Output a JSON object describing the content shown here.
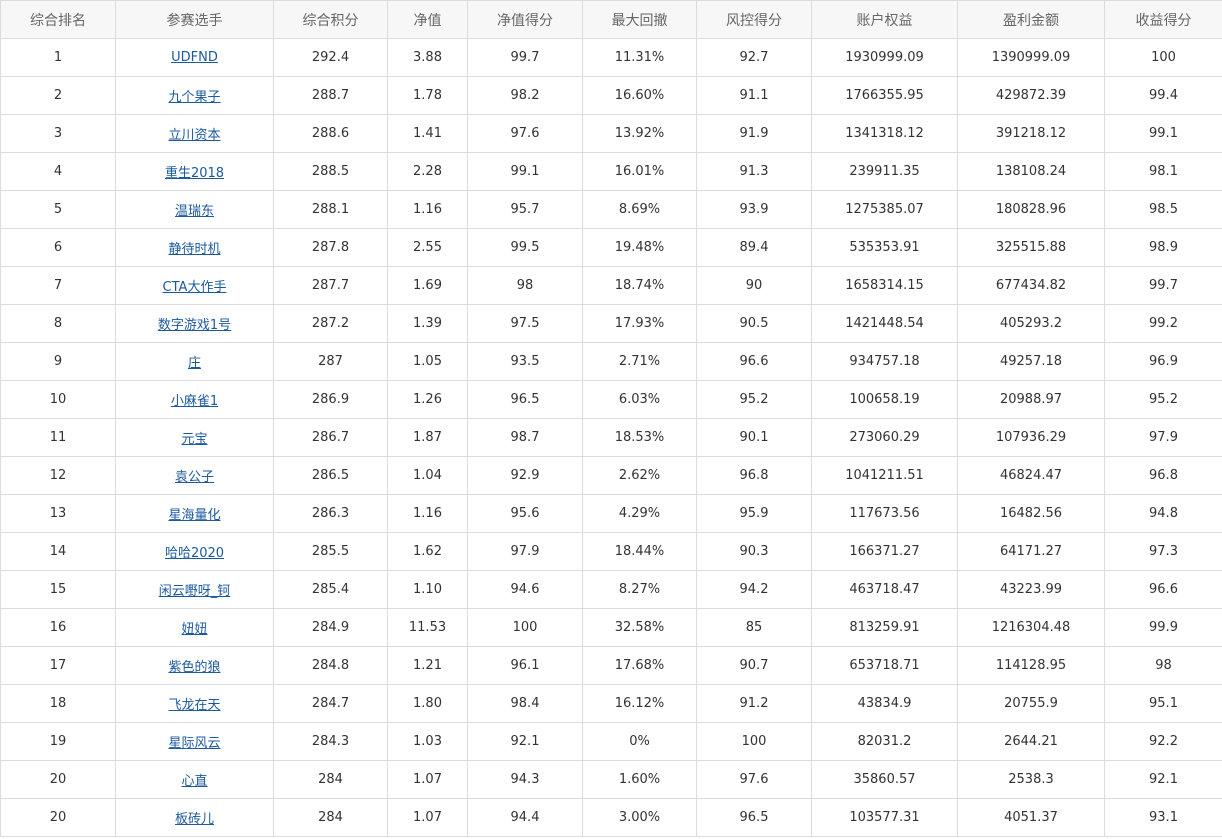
{
  "headers": [
    "综合排名",
    "参赛选手",
    "综合积分",
    "净值",
    "净值得分",
    "最大回撤",
    "风控得分",
    "账户权益",
    "盈利金额",
    "收益得分"
  ],
  "rows": [
    {
      "rank": "1",
      "name": "UDFND",
      "score": "292.4",
      "nav": "3.88",
      "nav_score": "99.7",
      "drawdown": "11.31%",
      "risk_score": "92.7",
      "equity": "1930999.09",
      "profit": "1390999.09",
      "return_score": "100"
    },
    {
      "rank": "2",
      "name": "九个果子",
      "score": "288.7",
      "nav": "1.78",
      "nav_score": "98.2",
      "drawdown": "16.60%",
      "risk_score": "91.1",
      "equity": "1766355.95",
      "profit": "429872.39",
      "return_score": "99.4"
    },
    {
      "rank": "3",
      "name": "立川资本",
      "score": "288.6",
      "nav": "1.41",
      "nav_score": "97.6",
      "drawdown": "13.92%",
      "risk_score": "91.9",
      "equity": "1341318.12",
      "profit": "391218.12",
      "return_score": "99.1"
    },
    {
      "rank": "4",
      "name": "重生2018",
      "score": "288.5",
      "nav": "2.28",
      "nav_score": "99.1",
      "drawdown": "16.01%",
      "risk_score": "91.3",
      "equity": "239911.35",
      "profit": "138108.24",
      "return_score": "98.1"
    },
    {
      "rank": "5",
      "name": "温瑞东",
      "score": "288.1",
      "nav": "1.16",
      "nav_score": "95.7",
      "drawdown": "8.69%",
      "risk_score": "93.9",
      "equity": "1275385.07",
      "profit": "180828.96",
      "return_score": "98.5"
    },
    {
      "rank": "6",
      "name": "静待时机",
      "score": "287.8",
      "nav": "2.55",
      "nav_score": "99.5",
      "drawdown": "19.48%",
      "risk_score": "89.4",
      "equity": "535353.91",
      "profit": "325515.88",
      "return_score": "98.9"
    },
    {
      "rank": "7",
      "name": "CTA大作手",
      "score": "287.7",
      "nav": "1.69",
      "nav_score": "98",
      "drawdown": "18.74%",
      "risk_score": "90",
      "equity": "1658314.15",
      "profit": "677434.82",
      "return_score": "99.7"
    },
    {
      "rank": "8",
      "name": "数字游戏1号",
      "score": "287.2",
      "nav": "1.39",
      "nav_score": "97.5",
      "drawdown": "17.93%",
      "risk_score": "90.5",
      "equity": "1421448.54",
      "profit": "405293.2",
      "return_score": "99.2"
    },
    {
      "rank": "9",
      "name": "庄",
      "score": "287",
      "nav": "1.05",
      "nav_score": "93.5",
      "drawdown": "2.71%",
      "risk_score": "96.6",
      "equity": "934757.18",
      "profit": "49257.18",
      "return_score": "96.9"
    },
    {
      "rank": "10",
      "name": "小麻雀1",
      "score": "286.9",
      "nav": "1.26",
      "nav_score": "96.5",
      "drawdown": "6.03%",
      "risk_score": "95.2",
      "equity": "100658.19",
      "profit": "20988.97",
      "return_score": "95.2"
    },
    {
      "rank": "11",
      "name": "元宝",
      "score": "286.7",
      "nav": "1.87",
      "nav_score": "98.7",
      "drawdown": "18.53%",
      "risk_score": "90.1",
      "equity": "273060.29",
      "profit": "107936.29",
      "return_score": "97.9"
    },
    {
      "rank": "12",
      "name": "袁公子",
      "score": "286.5",
      "nav": "1.04",
      "nav_score": "92.9",
      "drawdown": "2.62%",
      "risk_score": "96.8",
      "equity": "1041211.51",
      "profit": "46824.47",
      "return_score": "96.8"
    },
    {
      "rank": "13",
      "name": "星海量化",
      "score": "286.3",
      "nav": "1.16",
      "nav_score": "95.6",
      "drawdown": "4.29%",
      "risk_score": "95.9",
      "equity": "117673.56",
      "profit": "16482.56",
      "return_score": "94.8"
    },
    {
      "rank": "14",
      "name": "哈哈2020",
      "score": "285.5",
      "nav": "1.62",
      "nav_score": "97.9",
      "drawdown": "18.44%",
      "risk_score": "90.3",
      "equity": "166371.27",
      "profit": "64171.27",
      "return_score": "97.3"
    },
    {
      "rank": "15",
      "name": "闲云嘢呀_钶",
      "score": "285.4",
      "nav": "1.10",
      "nav_score": "94.6",
      "drawdown": "8.27%",
      "risk_score": "94.2",
      "equity": "463718.47",
      "profit": "43223.99",
      "return_score": "96.6"
    },
    {
      "rank": "16",
      "name": "妞妞",
      "score": "284.9",
      "nav": "11.53",
      "nav_score": "100",
      "drawdown": "32.58%",
      "risk_score": "85",
      "equity": "813259.91",
      "profit": "1216304.48",
      "return_score": "99.9"
    },
    {
      "rank": "17",
      "name": "紫色的狼",
      "score": "284.8",
      "nav": "1.21",
      "nav_score": "96.1",
      "drawdown": "17.68%",
      "risk_score": "90.7",
      "equity": "653718.71",
      "profit": "114128.95",
      "return_score": "98"
    },
    {
      "rank": "18",
      "name": "飞龙在天",
      "score": "284.7",
      "nav": "1.80",
      "nav_score": "98.4",
      "drawdown": "16.12%",
      "risk_score": "91.2",
      "equity": "43834.9",
      "profit": "20755.9",
      "return_score": "95.1"
    },
    {
      "rank": "19",
      "name": "星际风云",
      "score": "284.3",
      "nav": "1.03",
      "nav_score": "92.1",
      "drawdown": "0%",
      "risk_score": "100",
      "equity": "82031.2",
      "profit": "2644.21",
      "return_score": "92.2"
    },
    {
      "rank": "20",
      "name": "心直",
      "score": "284",
      "nav": "1.07",
      "nav_score": "94.3",
      "drawdown": "1.60%",
      "risk_score": "97.6",
      "equity": "35860.57",
      "profit": "2538.3",
      "return_score": "92.1"
    },
    {
      "rank": "20",
      "name": "板砖儿",
      "score": "284",
      "nav": "1.07",
      "nav_score": "94.4",
      "drawdown": "3.00%",
      "risk_score": "96.5",
      "equity": "103577.31",
      "profit": "4051.37",
      "return_score": "93.1"
    }
  ]
}
